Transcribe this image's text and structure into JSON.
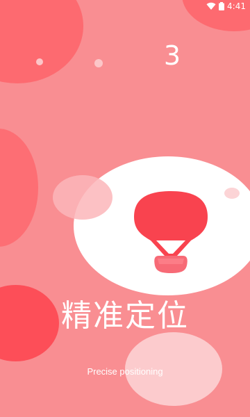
{
  "status_bar": {
    "time": "4:41",
    "icons": [
      "wifi-icon",
      "battery-icon"
    ]
  },
  "onboarding": {
    "countdown": "3",
    "title": "精准定位",
    "subtitle": "Precise positioning",
    "illustration": "hot-air-balloon-icon"
  },
  "colors": {
    "background": "#f98e92",
    "accent": "#f9434f",
    "blob_dark": "#fd5a62",
    "blob_light": "#ffffff"
  }
}
